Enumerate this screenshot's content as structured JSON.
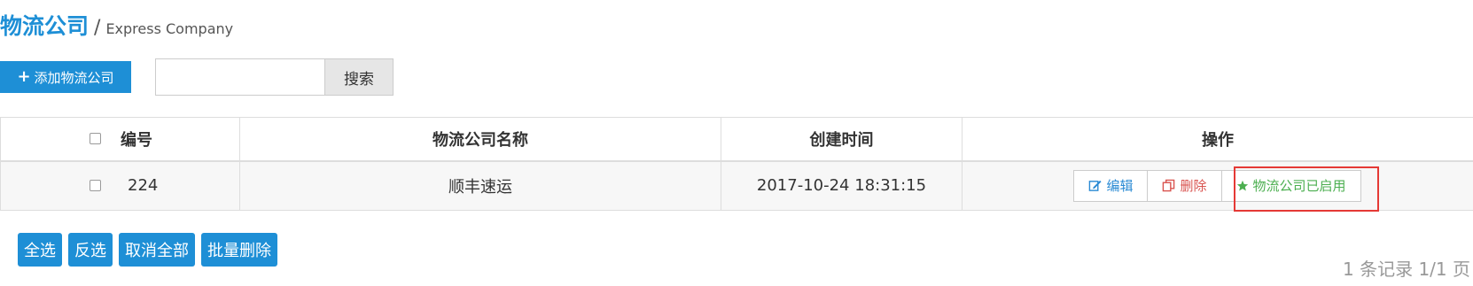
{
  "header": {
    "title": "物流公司",
    "separator": "/",
    "subtitle": "Express Company"
  },
  "toolbar": {
    "add_label": "添加物流公司",
    "add_icon": "plus-icon",
    "search_value": "",
    "search_button": "搜索"
  },
  "table": {
    "columns": [
      "编号",
      "物流公司名称",
      "创建时间",
      "操作"
    ],
    "rows": [
      {
        "id": "224",
        "name": "顺丰速运",
        "created": "2017-10-24 18:31:15"
      }
    ],
    "actions": {
      "edit": "编辑",
      "delete": "删除",
      "enabled": "物流公司已启用"
    }
  },
  "bulk": {
    "select_all": "全选",
    "invert": "反选",
    "deselect_all": "取消全部",
    "batch_delete": "批量删除"
  },
  "pager": {
    "text": "1 条记录 1/1 页"
  },
  "colors": {
    "accent": "#1e8fd6",
    "danger": "#d9534f",
    "success": "#4caf50",
    "highlight": "#e53935"
  }
}
